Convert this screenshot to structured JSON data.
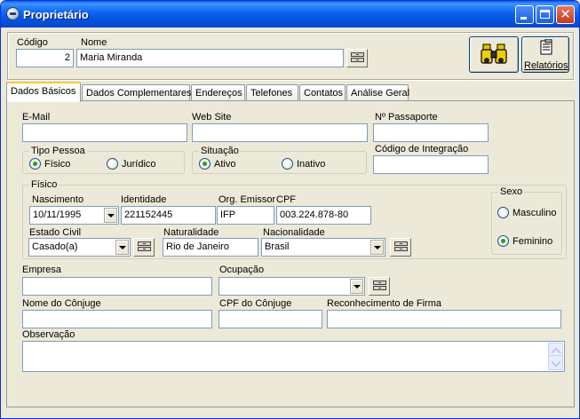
{
  "window": {
    "title": "Proprietário",
    "icon": "app-icon"
  },
  "header": {
    "codigo_label": "Código",
    "codigo_value": "2",
    "nome_label": "Nome",
    "nome_value": "Maria Miranda",
    "search_icon": "binoculars-icon",
    "relatorios_label": "Relatórios",
    "relatorios_icon": "report-icon"
  },
  "tabs": [
    {
      "label": "Dados Básicos",
      "active": true
    },
    {
      "label": "Dados Complementares"
    },
    {
      "label": "Endereços"
    },
    {
      "label": "Telefones"
    },
    {
      "label": "Contatos"
    },
    {
      "label": "Análise Geral"
    }
  ],
  "form": {
    "email_label": "E-Mail",
    "email_value": "",
    "website_label": "Web Site",
    "website_value": "",
    "passaporte_label": "Nº Passaporte",
    "passaporte_value": "",
    "tipo_pessoa": {
      "title": "Tipo Pessoa",
      "options": [
        "Físico",
        "Jurídico"
      ],
      "selected": "Físico"
    },
    "situacao": {
      "title": "Situação",
      "options": [
        "Ativo",
        "Inativo"
      ],
      "selected": "Ativo"
    },
    "codigo_integracao_label": "Código de Integração",
    "codigo_integracao_value": "",
    "fisico": {
      "title": "Físico",
      "nascimento_label": "Nascimento",
      "nascimento_value": "10/11/1995",
      "identidade_label": "Identidade",
      "identidade_value": "221152445",
      "org_emissor_label": "Org. Emissor",
      "org_emissor_value": "IFP",
      "cpf_label": "CPF",
      "cpf_value": "003.224.878-80",
      "estado_civil_label": "Estado Civil",
      "estado_civil_value": "Casado(a)",
      "naturalidade_label": "Naturalidade",
      "naturalidade_value": "Rio de Janeiro",
      "nacionalidade_label": "Nacionalidade",
      "nacionalidade_value": "Brasil",
      "sexo": {
        "title": "Sexo",
        "options": [
          "Masculino",
          "Feminino"
        ],
        "selected": "Feminino"
      }
    },
    "empresa_label": "Empresa",
    "empresa_value": "",
    "ocupacao_label": "Ocupação",
    "ocupacao_value": "",
    "nome_conjuge_label": "Nome do Cônjuge",
    "nome_conjuge_value": "",
    "cpf_conjuge_label": "CPF do Cônjuge",
    "cpf_conjuge_value": "",
    "reconhecimento_label": "Reconhecimento de Firma",
    "reconhecimento_value": "",
    "observacao_label": "Observação",
    "observacao_value": ""
  },
  "colors": {
    "titlebar": "#0554E0",
    "face": "#ECE9D8",
    "tab_accent": "#FFC83C",
    "radio_dot": "#21A121"
  }
}
